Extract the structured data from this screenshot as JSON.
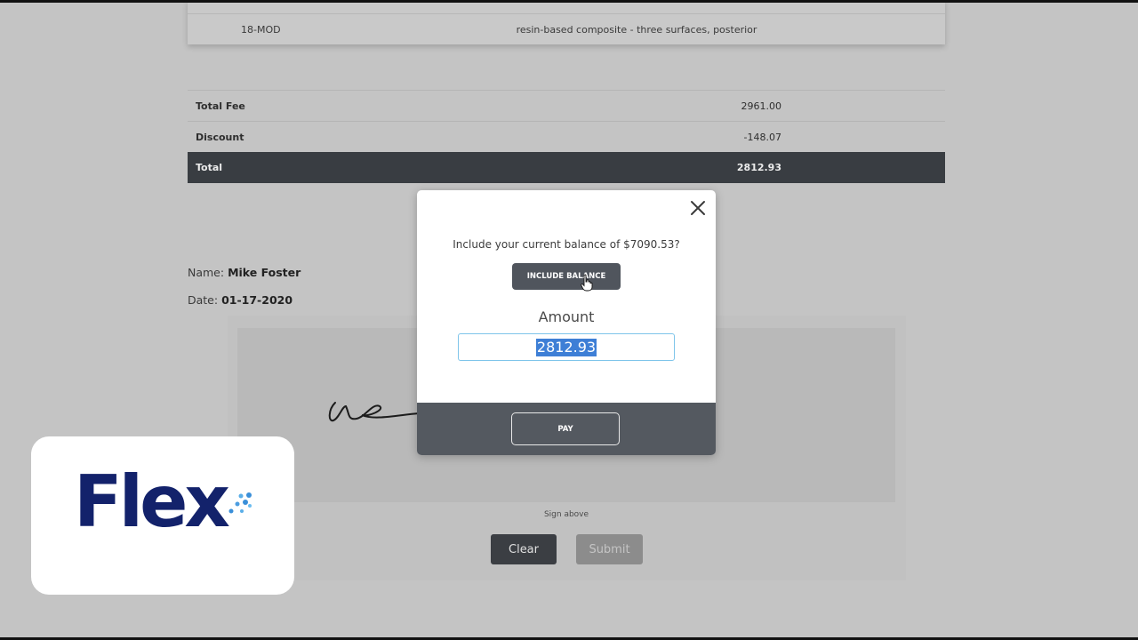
{
  "procedure": {
    "code": "18-MOD",
    "description": "resin-based composite - three surfaces, posterior"
  },
  "totals": {
    "rows": [
      {
        "label": "Total Fee",
        "value": "2961.00"
      },
      {
        "label": "Discount",
        "value": "-148.07"
      },
      {
        "label": "Total",
        "value": "2812.93"
      }
    ]
  },
  "patient": {
    "name_label": "Name:",
    "name": "Mike Foster",
    "date_label": "Date:",
    "date": "01-17-2020"
  },
  "signature": {
    "hint": "Sign above",
    "clear_label": "Clear",
    "submit_label": "Submit"
  },
  "modal": {
    "prompt": "Include your current balance of $7090.53?",
    "include_label": "INCLUDE BALANCE",
    "amount_label": "Amount",
    "amount_value": "2812.93",
    "pay_label": "PAY"
  },
  "logo": {
    "text": "Flex",
    "color": "#13226b",
    "accent": "#3a8fd9"
  },
  "colors": {
    "dark_button": "#50555d",
    "total_row": "#393d42",
    "input_focus": "#7ec4ea"
  }
}
